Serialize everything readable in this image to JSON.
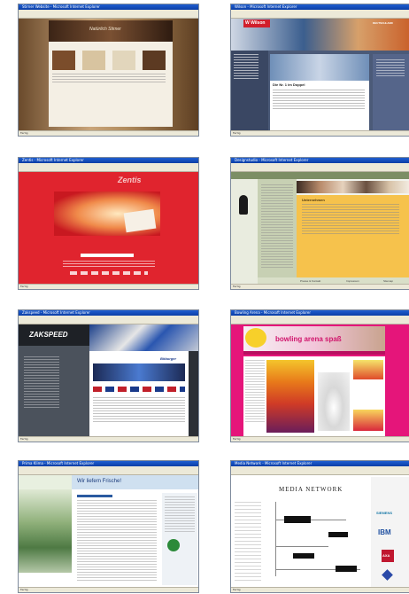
{
  "gallery": {
    "shots": [
      {
        "window_title": "Stirner Website - Microsoft Internet Explorer",
        "heading": "Natürlich Stirner",
        "status": "Fertig"
      },
      {
        "window_title": "Wilson - Microsoft Internet Explorer",
        "brand": "W Wilson",
        "country": "DEUTSCHLAND",
        "headline": "Die Nr. 1 im Doppel",
        "status": "Fertig"
      },
      {
        "window_title": "Zentis - Microsoft Internet Explorer",
        "brand": "Zentis",
        "status": "Fertig"
      },
      {
        "window_title": "Designstudio - Microsoft Internet Explorer",
        "section": "Unternehmen",
        "footer_items": [
          "Presse & Kontakt",
          "Impressum",
          "Sitemap"
        ],
        "status": "Fertig"
      },
      {
        "window_title": "Zakspeed - Microsoft Internet Explorer",
        "brand": "ZAKSPEED",
        "sponsor": "Bitburger",
        "status": "Fertig"
      },
      {
        "window_title": "Bowling Arena - Microsoft Internet Explorer",
        "banner": "bowling arena spaß",
        "status": "Fertig"
      },
      {
        "window_title": "Prima Klima - Microsoft Internet Explorer",
        "tagline": "Wir liefern Frische!",
        "status": "Fertig"
      },
      {
        "window_title": "Media Network - Microsoft Internet Explorer",
        "brand": "MEDIA NETWORK",
        "logos": [
          "SIEMENS",
          "IBM",
          "AXA"
        ],
        "status": "Fertig"
      }
    ]
  }
}
